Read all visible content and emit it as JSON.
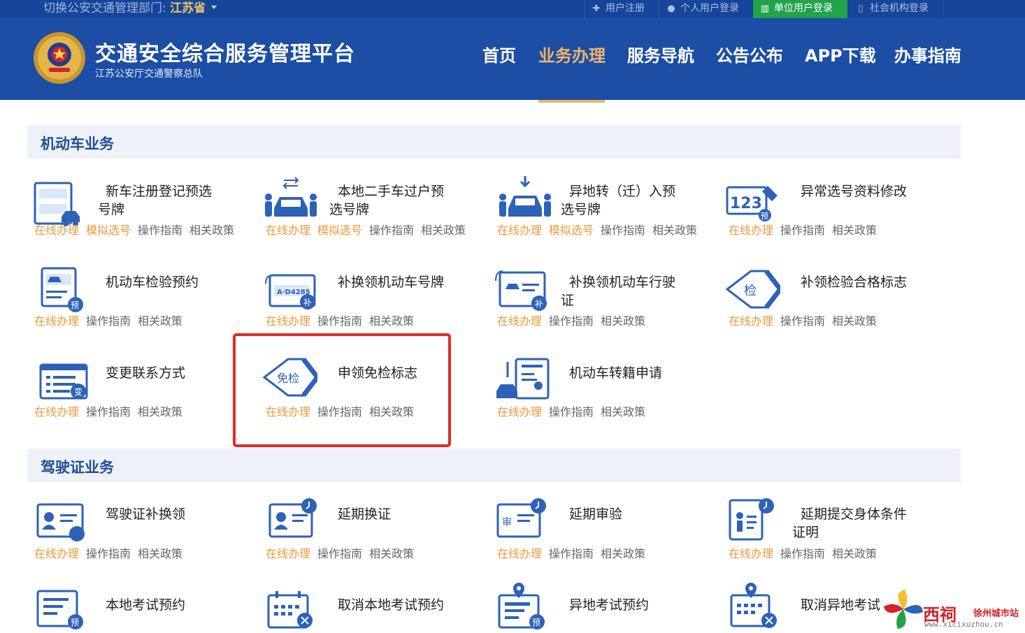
{
  "topbar": {
    "region_label": "切换公安交通管理部门:",
    "region_value": "江苏省",
    "links": [
      {
        "label": "用户注册",
        "icon": "plus-icon"
      },
      {
        "label": "个人用户登录",
        "icon": "user-icon"
      },
      {
        "label": "单位用户登录",
        "icon": "building-icon"
      },
      {
        "label": "社会机构登录",
        "icon": "document-icon"
      }
    ]
  },
  "header": {
    "title": "交通安全综合服务管理平台",
    "subtitle": "江苏公安厅交通警察总队",
    "nav": [
      "首页",
      "业务办理",
      "服务导航",
      "公告公布",
      "APP下载",
      "办事指南"
    ],
    "active_nav": "业务办理"
  },
  "sections": {
    "vehicle": {
      "title": "机动车业务",
      "items": [
        {
          "title1": "新车注册登记预选",
          "title2": "号牌",
          "links": [
            "在线办理",
            "模拟选号",
            "操作指南",
            "相关政策"
          ],
          "icon": "new-car-registration-icon"
        },
        {
          "title1": "本地二手车过户预",
          "title2": "选号牌",
          "links": [
            "在线办理",
            "模拟选号",
            "操作指南",
            "相关政策"
          ],
          "icon": "car-transfer-icon"
        },
        {
          "title1": "异地转（迁）入预",
          "title2": "选号牌",
          "links": [
            "在线办理",
            "模拟选号",
            "操作指南",
            "相关政策"
          ],
          "icon": "car-relocation-icon"
        },
        {
          "title1": "异常选号资料修改",
          "title2": "",
          "links": [
            "在线办理",
            "操作指南",
            "相关政策"
          ],
          "icon": "plate-edit-icon"
        },
        {
          "title1": "机动车检验预约",
          "title2": "",
          "links": [
            "在线办理",
            "操作指南",
            "相关政策"
          ],
          "icon": "inspection-booking-icon"
        },
        {
          "title1": "补换领机动车号牌",
          "title2": "",
          "links": [
            "在线办理",
            "操作指南",
            "相关政策"
          ],
          "icon": "plate-replace-icon"
        },
        {
          "title1": "补换领机动车行驶",
          "title2": "证",
          "links": [
            "在线办理",
            "操作指南",
            "相关政策"
          ],
          "icon": "license-replace-icon"
        },
        {
          "title1": "补领检验合格标志",
          "title2": "",
          "links": [
            "在线办理",
            "操作指南",
            "相关政策"
          ],
          "icon": "inspection-mark-icon"
        },
        {
          "title1": "变更联系方式",
          "title2": "",
          "links": [
            "在线办理",
            "操作指南",
            "相关政策"
          ],
          "icon": "contact-change-icon"
        },
        {
          "title1": "申领免检标志",
          "title2": "",
          "links": [
            "在线办理",
            "操作指南",
            "相关政策"
          ],
          "icon": "exempt-mark-icon"
        },
        {
          "title1": "机动车转籍申请",
          "title2": "",
          "links": [
            "在线办理",
            "操作指南",
            "相关政策"
          ],
          "icon": "vehicle-transfer-icon"
        }
      ]
    },
    "driver": {
      "title": "驾驶证业务",
      "items": [
        {
          "title1": "驾驶证补换领",
          "title2": "",
          "links": [
            "在线办理",
            "操作指南",
            "相关政策"
          ],
          "icon": "license-renew-icon"
        },
        {
          "title1": "延期换证",
          "title2": "",
          "links": [
            "在线办理",
            "操作指南",
            "相关政策"
          ],
          "icon": "delay-renew-icon"
        },
        {
          "title1": "延期审验",
          "title2": "",
          "links": [
            "在线办理",
            "操作指南",
            "相关政策"
          ],
          "icon": "delay-review-icon"
        },
        {
          "title1": "延期提交身体条件",
          "title2": "证明",
          "links": [
            "在线办理",
            "操作指南",
            "相关政策"
          ],
          "icon": "health-cert-icon"
        },
        {
          "title1": "本地考试预约",
          "title2": "",
          "links": [],
          "icon": "exam-booking-icon"
        },
        {
          "title1": "取消本地考试预约",
          "title2": "",
          "links": [],
          "icon": "exam-cancel-icon"
        },
        {
          "title1": "异地考试预约",
          "title2": "",
          "links": [],
          "icon": "remote-exam-icon"
        },
        {
          "title1": "取消异地考试",
          "title2": "",
          "links": [],
          "icon": "remote-exam-cancel-icon"
        }
      ]
    }
  },
  "watermark": {
    "brand": "西祠",
    "city": "徐州城市站",
    "url": "www.xicixuzhou.cn"
  },
  "colors": {
    "topbar": "#16469a",
    "header": "#1b4ea4",
    "accent": "#f1b36b",
    "link_orange": "#e89a3c",
    "icon_blue": "#2d62b8",
    "highlight_red": "#e32b23"
  }
}
